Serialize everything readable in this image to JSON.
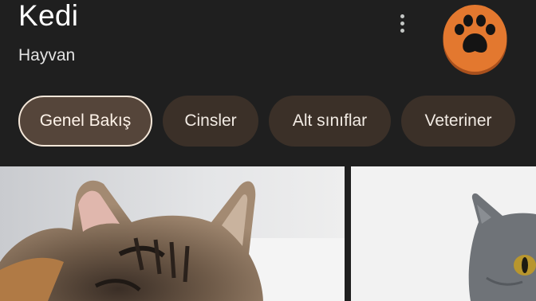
{
  "header": {
    "title": "Kedi",
    "subtitle": "Hayvan",
    "more_icon": "more-vert-icon",
    "avatar_icon": "paw-icon"
  },
  "tabs": [
    {
      "label": "Genel Bakış",
      "selected": true
    },
    {
      "label": "Cinsler",
      "selected": false
    },
    {
      "label": "Alt sınıflar",
      "selected": false
    },
    {
      "label": "Veteriner",
      "selected": false
    }
  ],
  "images": [
    {
      "subject": "tabby kitten"
    },
    {
      "subject": "gray cat"
    }
  ],
  "colors": {
    "background": "#1f1f1f",
    "chip": "#3b3028",
    "chip_selected": "#55453a",
    "chip_selected_border": "#f3e6d8",
    "avatar_orange": "#e3782f"
  }
}
